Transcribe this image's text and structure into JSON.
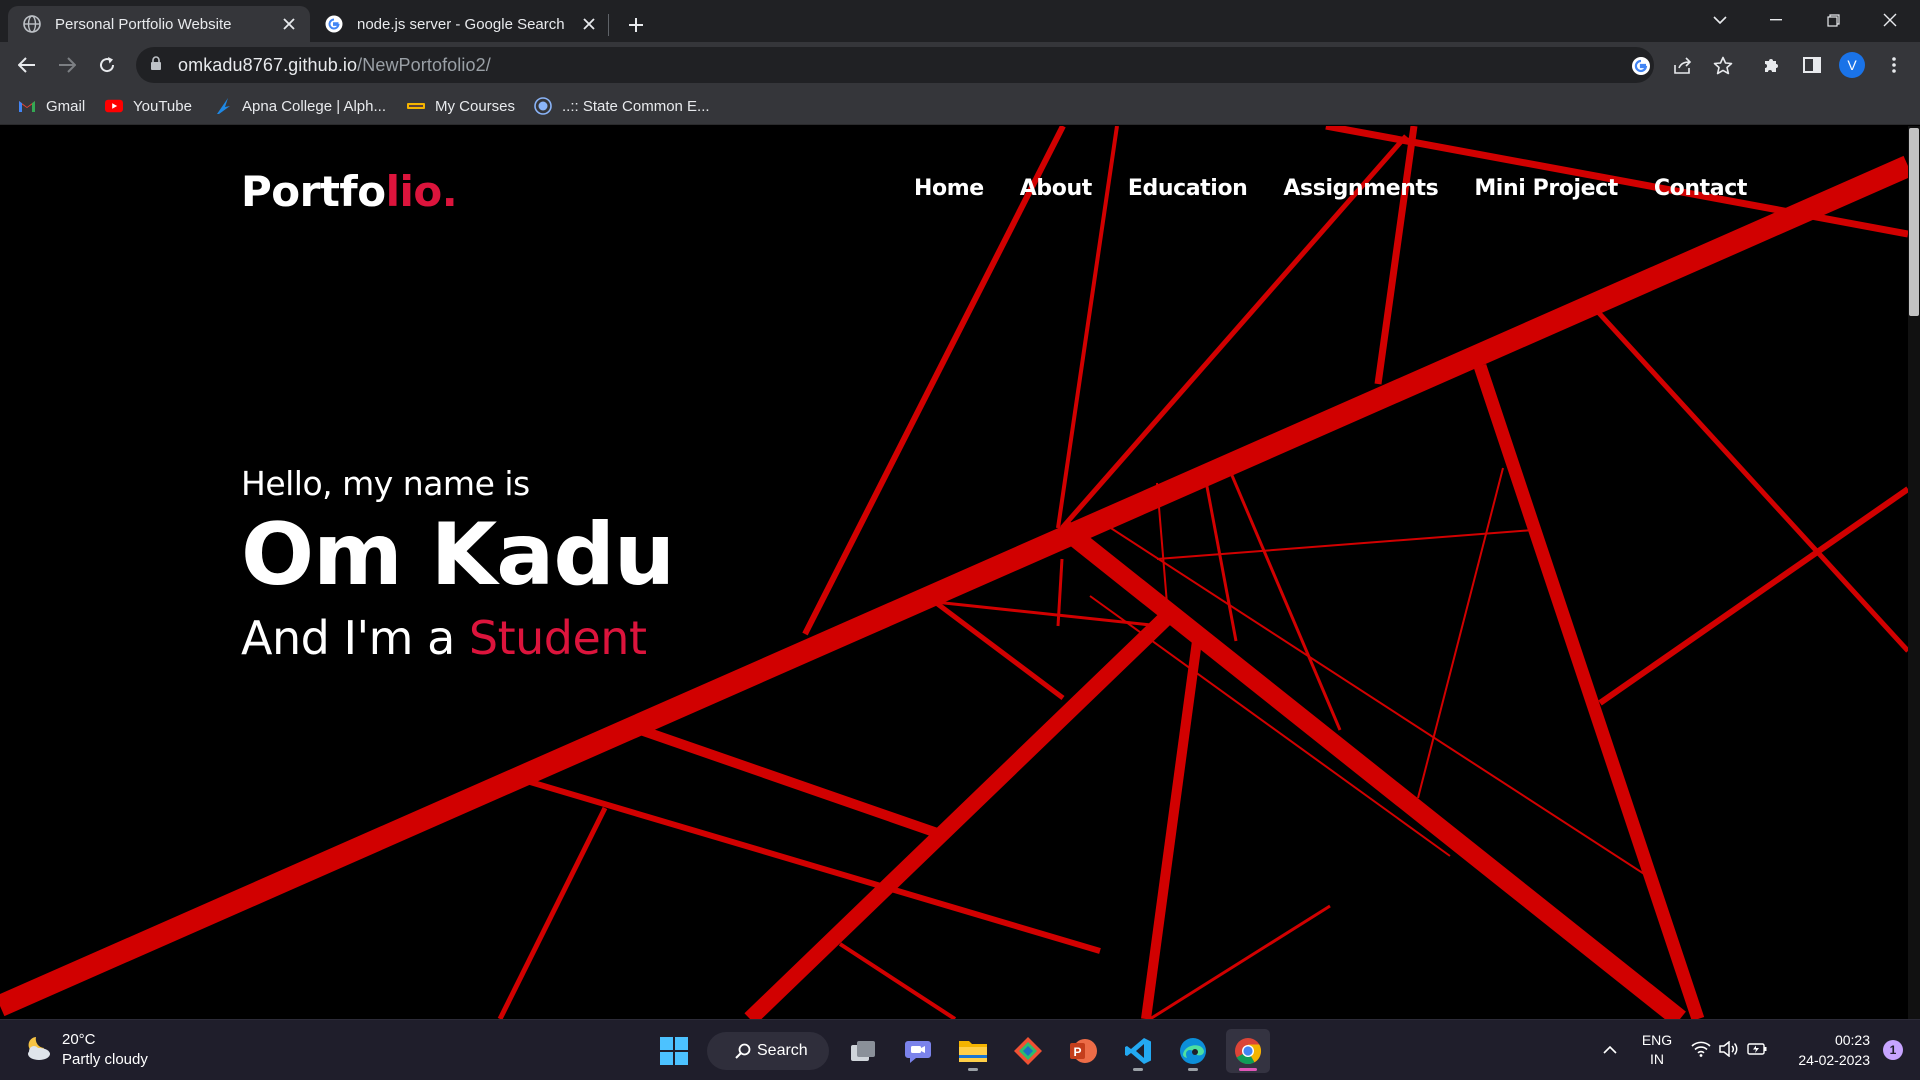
{
  "browser": {
    "tabs": [
      {
        "title": "Personal Portfolio Website",
        "active": true
      },
      {
        "title": "node.js server - Google Search",
        "active": false
      }
    ],
    "url_host": "omkadu8767.github.io",
    "url_path": "/NewPortofolio2/",
    "profile_initial": "V",
    "bookmarks": [
      "Gmail",
      "YouTube",
      "Apna College | Alph...",
      "My Courses",
      "..:: State Common E..."
    ]
  },
  "page": {
    "logo_main": "Portfo",
    "logo_accent": "lio.",
    "nav": [
      "Home",
      "About",
      "Education",
      "Assignments",
      "Mini Project",
      "Contact"
    ],
    "hero": {
      "greeting": "Hello, my name is",
      "name": "Om Kadu",
      "role_prefix": "And I'm a ",
      "role": "Student"
    },
    "colors": {
      "accent": "#dc143c",
      "lines": "#d10000",
      "background": "#000000"
    }
  },
  "taskbar": {
    "weather_temp": "20°C",
    "weather_desc": "Partly cloudy",
    "search_label": "Search",
    "lang_top": "ENG",
    "lang_bottom": "IN",
    "time": "00:23",
    "date": "24-02-2023",
    "notification_count": "1"
  }
}
